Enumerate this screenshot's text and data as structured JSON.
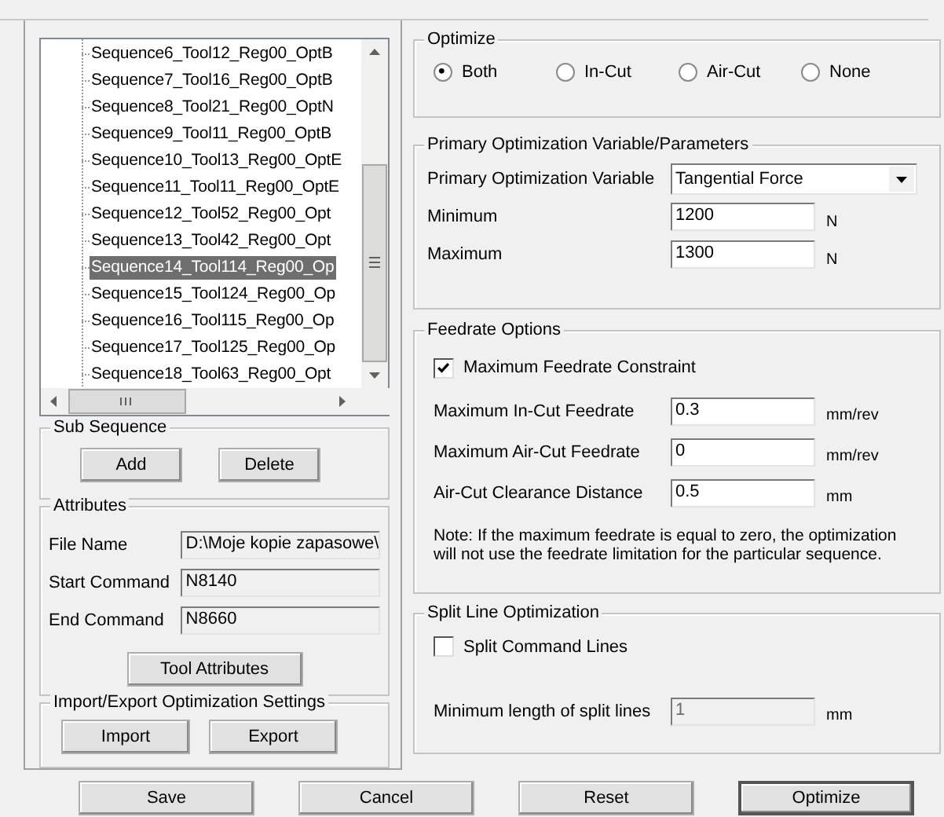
{
  "sequence_tree": {
    "items": [
      {
        "label": "Sequence6_Tool12_Reg00_OptB",
        "selected": false
      },
      {
        "label": "Sequence7_Tool16_Reg00_OptB",
        "selected": false
      },
      {
        "label": "Sequence8_Tool21_Reg00_OptN",
        "selected": false
      },
      {
        "label": "Sequence9_Tool11_Reg00_OptB",
        "selected": false
      },
      {
        "label": "Sequence10_Tool13_Reg00_OptE",
        "selected": false
      },
      {
        "label": "Sequence11_Tool11_Reg00_OptE",
        "selected": false
      },
      {
        "label": "Sequence12_Tool52_Reg00_Opt",
        "selected": false
      },
      {
        "label": "Sequence13_Tool42_Reg00_Opt",
        "selected": false
      },
      {
        "label": "Sequence14_Tool114_Reg00_Op",
        "selected": true
      },
      {
        "label": "Sequence15_Tool124_Reg00_Op",
        "selected": false
      },
      {
        "label": "Sequence16_Tool115_Reg00_Op",
        "selected": false
      },
      {
        "label": "Sequence17_Tool125_Reg00_Op",
        "selected": false
      },
      {
        "label": "Sequence18_Tool63_Reg00_Opt",
        "selected": false
      }
    ]
  },
  "sub_sequence": {
    "title": "Sub Sequence",
    "buttons": [
      "Add",
      "Delete"
    ]
  },
  "attributes": {
    "title": "Attributes",
    "fields": [
      {
        "label": "File Name",
        "value": "D:\\Moje kopie zapasowe\\",
        "readonly": true
      },
      {
        "label": "Start Command",
        "value": "N8140",
        "readonly": true
      },
      {
        "label": "End Command",
        "value": "N8660",
        "readonly": true
      }
    ],
    "button": "Tool Attributes"
  },
  "import_export": {
    "title": "Import/Export Optimization Settings",
    "buttons": [
      "Import",
      "Export"
    ]
  },
  "optimize": {
    "title": "Optimize",
    "options": [
      {
        "label": "Both",
        "selected": true
      },
      {
        "label": "In-Cut",
        "selected": false
      },
      {
        "label": "Air-Cut",
        "selected": false
      },
      {
        "label": "None",
        "selected": false
      }
    ]
  },
  "primary": {
    "title": "Primary Optimization Variable/Parameters",
    "variable": {
      "label": "Primary Optimization Variable",
      "value": "Tangential Force"
    },
    "fields": [
      {
        "label": "Minimum",
        "value": "1200",
        "unit": "N"
      },
      {
        "label": "Maximum",
        "value": "1300",
        "unit": "N"
      }
    ]
  },
  "feedrate": {
    "title": "Feedrate Options",
    "constraint": {
      "label": "Maximum Feedrate Constraint",
      "checked": true
    },
    "fields": [
      {
        "label": "Maximum In-Cut Feedrate",
        "value": "0.3",
        "unit": "mm/rev"
      },
      {
        "label": "Maximum Air-Cut Feedrate",
        "value": "0",
        "unit": "mm/rev"
      },
      {
        "label": "Air-Cut Clearance Distance",
        "value": "0.5",
        "unit": "mm"
      }
    ],
    "note": "Note: If the maximum feedrate is equal to zero, the optimization will not use the feedrate limitation for the particular sequence."
  },
  "split_line": {
    "title": "Split Line Optimization",
    "split": {
      "label": "Split Command Lines",
      "checked": false
    },
    "min_length": {
      "label": "Minimum length of split lines",
      "value": "1",
      "unit": "mm",
      "disabled": true
    }
  },
  "buttons": [
    {
      "label": "Save",
      "default": false
    },
    {
      "label": "Cancel",
      "default": false
    },
    {
      "label": "Reset",
      "default": false
    },
    {
      "label": "Optimize",
      "default": true
    }
  ]
}
